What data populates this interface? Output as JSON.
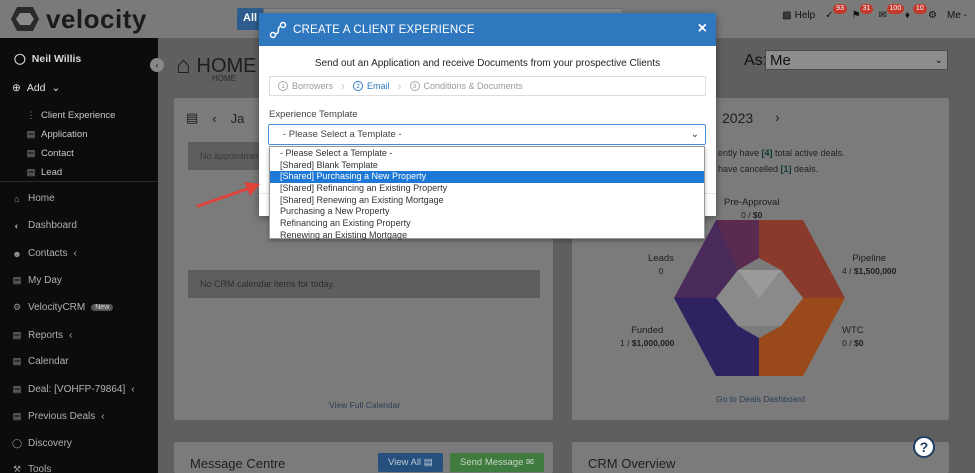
{
  "brand": {
    "name": "velocity"
  },
  "topbar": {
    "search_scope": "All",
    "help_label": "Help",
    "badges": [
      "93",
      "31",
      "100",
      "10"
    ],
    "me_label": "Me -"
  },
  "sidebar": {
    "user_name": "Neil Willis",
    "add_label": "Add",
    "add_items": [
      "Client Experience",
      "Application",
      "Contact",
      "Lead"
    ],
    "nav": [
      {
        "label": "Home"
      },
      {
        "label": "Dashboard"
      },
      {
        "label": "Contacts"
      },
      {
        "label": "My Day"
      },
      {
        "label": "VelocityCRM",
        "tag": "New"
      },
      {
        "label": "Reports"
      },
      {
        "label": "Calendar"
      },
      {
        "label": "Deal: [VOHFP-79864]"
      },
      {
        "label": "Previous Deals"
      },
      {
        "label": "Discovery"
      },
      {
        "label": "Tools"
      }
    ]
  },
  "main": {
    "title": "HOME",
    "breadcrumb": "HOME",
    "as_label": "As:",
    "as_value": "Me",
    "calendar": {
      "month_partial": "Ja",
      "no_appointments": "No appointmen",
      "no_crm": "No CRM calendar items for today.",
      "view_full": "View Full Calendar"
    },
    "deals": {
      "year": "2023",
      "active_prefix": "ently have ",
      "active_count": "[4]",
      "active_suffix": " total active deals.",
      "cancel_prefix": " have cancelled ",
      "cancel_count": "[1]",
      "cancel_suffix": " deals.",
      "stages": {
        "preapproval": {
          "name": "Pre-Approval",
          "count": "0",
          "value": "$0"
        },
        "leads": {
          "name": "Leads",
          "count": "0"
        },
        "pipeline": {
          "name": "Pipeline",
          "count": "4",
          "value": "$1,500,000"
        },
        "funded": {
          "name": "Funded",
          "count": "1",
          "value": "$1,000,000"
        },
        "wtc": {
          "name": "WTC",
          "count": "0",
          "value": "$0"
        }
      },
      "go_link": "Go to Deals Dashboard"
    },
    "message_centre": {
      "title": "Message Centre",
      "view_all": "View All",
      "send": "Send Message"
    },
    "crm_overview": {
      "title": "CRM Overview"
    }
  },
  "modal": {
    "title": "CREATE A CLIENT EXPERIENCE",
    "close": "×",
    "intro": "Send out an Application and receive Documents from your prospective Clients",
    "steps": [
      {
        "num": "1",
        "label": "Borrowers"
      },
      {
        "num": "2",
        "label": "Email"
      },
      {
        "num": "3",
        "label": "Conditions & Documents"
      }
    ],
    "active_step": 1,
    "template_label": "Experience Template",
    "template_value": "- Please Select a Template -"
  },
  "dropdown": {
    "options": [
      "- Please Select a Template -",
      "[Shared] Blank Template",
      "[Shared] Purchasing a New Property",
      "[Shared] Refinancing an Existing Property",
      "[Shared] Renewing an Existing Mortgage",
      "Purchasing a New Property",
      "Refinancing an Existing Property",
      "Renewing an Existing Mortgage"
    ],
    "selected_index": 2
  },
  "colors": {
    "accent": "#2f78bf",
    "highlight": "#1e78d6",
    "arrow": "#e0433a"
  }
}
